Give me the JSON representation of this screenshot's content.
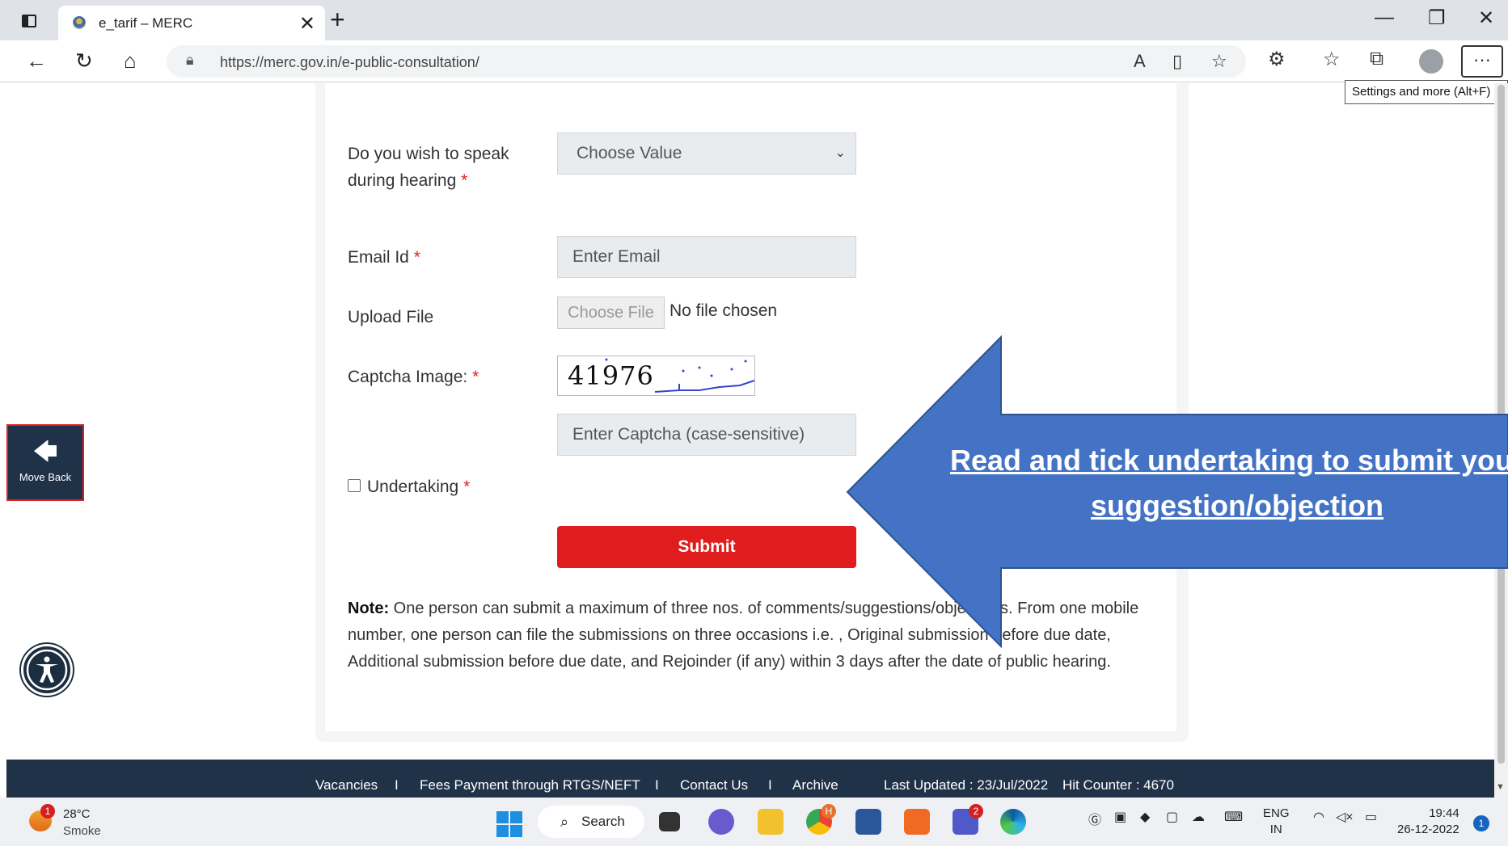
{
  "browser": {
    "tab_title": "e_tarif – MERC",
    "url": "https://merc.gov.in/e-public-consultation/",
    "tooltip": "Settings and more (Alt+F)",
    "more_label": "···"
  },
  "form": {
    "hearing_label": "Do you wish to speak during hearing",
    "hearing_value": "Choose Value",
    "email_label": "Email Id",
    "email_placeholder": "Enter Email",
    "upload_label": "Upload File",
    "choose_file": "Choose File",
    "no_file": "No file chosen",
    "captcha_label": "Captcha Image:",
    "captcha_text": "41976",
    "captcha_placeholder": "Enter Captcha (case-sensitive)",
    "undertaking_label": "Undertaking",
    "submit_label": "Submit",
    "required_mark": "*"
  },
  "note": {
    "prefix": "Note:",
    "text": "One person can submit a maximum of three nos. of comments/suggestions/objections. From one mobile number, one person can file the submissions on three occasions i.e. , Original submission before due date, Additional submission before due date, and Rejoinder (if any) within 3 days after the date of public hearing."
  },
  "move_back": "Move Back",
  "annotation": {
    "line1": "Read and tick undertaking to submit your",
    "line2": "suggestion/objection"
  },
  "footer": {
    "links": [
      "Vacancies",
      "Fees Payment through RTGS/NEFT",
      "Contact Us",
      "Archive"
    ],
    "separator": "I",
    "last_updated": "Last Updated : 23/Jul/2022",
    "hit_counter": "Hit Counter : 4670"
  },
  "taskbar": {
    "weather_badge": "1",
    "temperature": "28°C",
    "condition": "Smoke",
    "search_label": "Search",
    "chrome_badge": "H",
    "teams_badge": "2",
    "lang_line1": "ENG",
    "lang_line2": "IN",
    "time": "19:44",
    "date": "26-12-2022",
    "notif_count": "1"
  }
}
